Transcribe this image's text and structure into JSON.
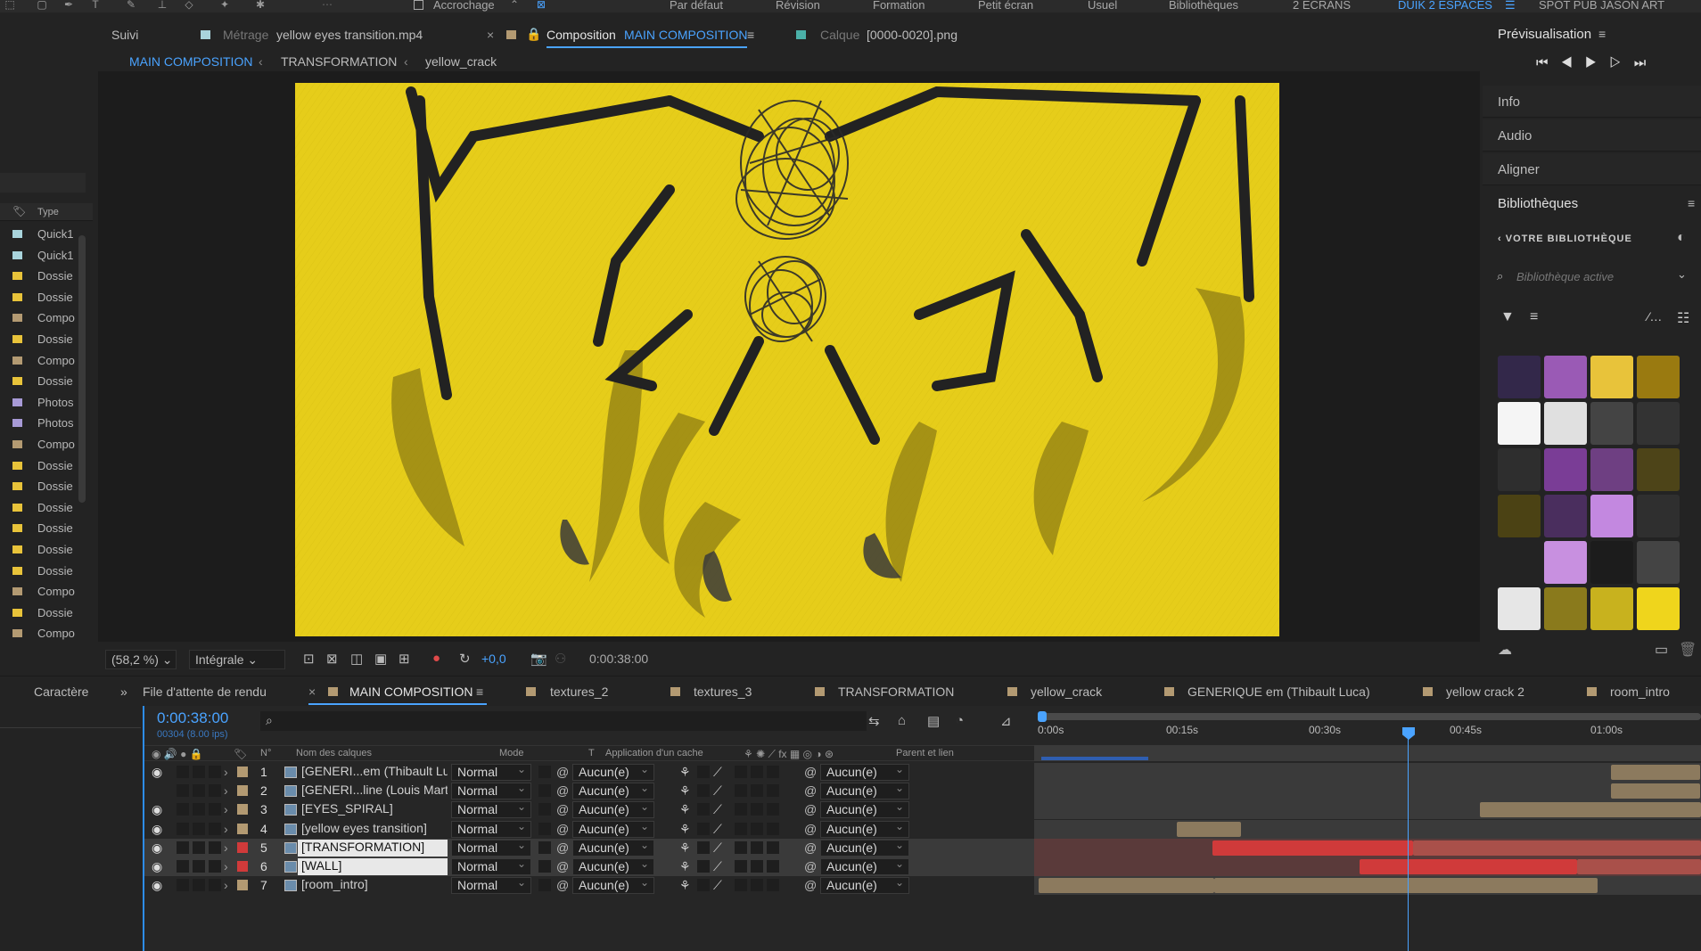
{
  "toolbar": {
    "snapping_label": "Accrochage",
    "workspaces": [
      "Par défaut",
      "Révision",
      "Formation",
      "Petit écran",
      "Usuel",
      "Bibliothèques",
      "2 ECRANS"
    ],
    "active_workspace": "DUIK 2 ESPACES",
    "extra_workspace": "SPOT PUB JASON ART"
  },
  "viewer": {
    "tab_tracking": "Suivi",
    "tab_footage_prefix": "Métrage",
    "tab_footage_name": "yellow eyes transition.mp4",
    "tab_comp_prefix": "Composition",
    "tab_comp_name": "MAIN COMPOSITION",
    "tab_layer_prefix": "Calque",
    "tab_layer_name": "[0000-0020].png",
    "breadcrumbs": [
      "MAIN COMPOSITION",
      "TRANSFORMATION",
      "yellow_crack"
    ],
    "zoom": "(58,2 %)",
    "resolution": "Intégrale",
    "exposure": "+0,0",
    "timecode": "0:00:38:00"
  },
  "project": {
    "type_header": "Type",
    "items": [
      {
        "name": "Quick1",
        "color": "#a9d4dc"
      },
      {
        "name": "Quick1",
        "color": "#a9d4dc"
      },
      {
        "name": "Dossie",
        "color": "#e8c33a"
      },
      {
        "name": "Dossie",
        "color": "#e8c33a"
      },
      {
        "name": "Compo",
        "color": "#b39a72"
      },
      {
        "name": "Dossie",
        "color": "#e8c33a"
      },
      {
        "name": "Compo",
        "color": "#b39a72"
      },
      {
        "name": "Dossie",
        "color": "#e8c33a"
      },
      {
        "name": "Photos",
        "color": "#a79ad6"
      },
      {
        "name": "Photos",
        "color": "#a79ad6"
      },
      {
        "name": "Compo",
        "color": "#b39a72"
      },
      {
        "name": "Dossie",
        "color": "#e8c33a"
      },
      {
        "name": "Dossie",
        "color": "#e8c33a"
      },
      {
        "name": "Dossie",
        "color": "#e8c33a"
      },
      {
        "name": "Dossie",
        "color": "#e8c33a"
      },
      {
        "name": "Dossie",
        "color": "#e8c33a"
      },
      {
        "name": "Dossie",
        "color": "#e8c33a"
      },
      {
        "name": "Compo",
        "color": "#b39a72"
      },
      {
        "name": "Dossie",
        "color": "#e8c33a"
      },
      {
        "name": "Compo",
        "color": "#b39a72"
      }
    ]
  },
  "right": {
    "preview_title": "Prévisualisation",
    "sections": [
      "Info",
      "Audio",
      "Aligner"
    ],
    "libraries_title": "Bibliothèques",
    "library_back": "VOTRE BIBLIOTHÈQUE",
    "library_search_placeholder": "Bibliothèque active",
    "swatches": [
      "#33284a",
      "#9a5ab5",
      "#e8c33a",
      "#9a7a10",
      "#f5f5f5",
      "#e0e0e0",
      "#444444",
      "#333333",
      "#2e2e2e",
      "#7a3d96",
      "#6e3f82",
      "#4d4418",
      "#4b4214",
      "#4a2e5e",
      "#c388e0",
      "#2f2f2f",
      "",
      "#c890e0",
      "#1c1c1c",
      "#444444",
      "#e6e6e6",
      "#8a7a1c",
      "#c8b21e",
      "#efd51c"
    ]
  },
  "timeline": {
    "side_tab": "Caractère",
    "tabs": [
      "File d'attente de rendu",
      "MAIN COMPOSITION",
      "textures_2",
      "textures_3",
      "TRANSFORMATION",
      "yellow_crack",
      "GENERIQUE em (Thibault Luca)",
      "yellow crack 2",
      "room_intro"
    ],
    "current_time": "0:00:38:00",
    "frame_info": "00304 (8.00 ips)",
    "columns": {
      "num": "N°",
      "name": "Nom des calques",
      "mode": "Mode",
      "t": "T",
      "trkmat": "Application d'un cache",
      "parent": "Parent et lien"
    },
    "ruler": [
      "0:00s",
      "00:15s",
      "00:30s",
      "00:45s",
      "01:00s"
    ],
    "layers": [
      {
        "num": "1",
        "name": "[GENERI...em (Thibault Luca)]",
        "mode": "Normal",
        "trkmat": "Aucun(e)",
        "parent": "Aucun(e)",
        "color": "#b39a72",
        "visible": true
      },
      {
        "num": "2",
        "name": "[GENERI...line (Louis Martin)]",
        "mode": "Normal",
        "trkmat": "Aucun(e)",
        "parent": "Aucun(e)",
        "color": "#b39a72",
        "visible": false
      },
      {
        "num": "3",
        "name": "[EYES_SPIRAL]",
        "mode": "Normal",
        "trkmat": "Aucun(e)",
        "parent": "Aucun(e)",
        "color": "#b39a72",
        "visible": true
      },
      {
        "num": "4",
        "name": "[yellow eyes transition]",
        "mode": "Normal",
        "trkmat": "Aucun(e)",
        "parent": "Aucun(e)",
        "color": "#b39a72",
        "visible": true
      },
      {
        "num": "5",
        "name": "[TRANSFORMATION]",
        "mode": "Normal",
        "trkmat": "Aucun(e)",
        "parent": "Aucun(e)",
        "color": "#d03a3a",
        "visible": true
      },
      {
        "num": "6",
        "name": "[WALL]",
        "mode": "Normal",
        "trkmat": "Aucun(e)",
        "parent": "Aucun(e)",
        "color": "#d03a3a",
        "visible": true
      },
      {
        "num": "7",
        "name": "[room_intro]",
        "mode": "Normal",
        "trkmat": "Aucun(e)",
        "parent": "Aucun(e)",
        "color": "#b39a72",
        "visible": true
      }
    ]
  }
}
